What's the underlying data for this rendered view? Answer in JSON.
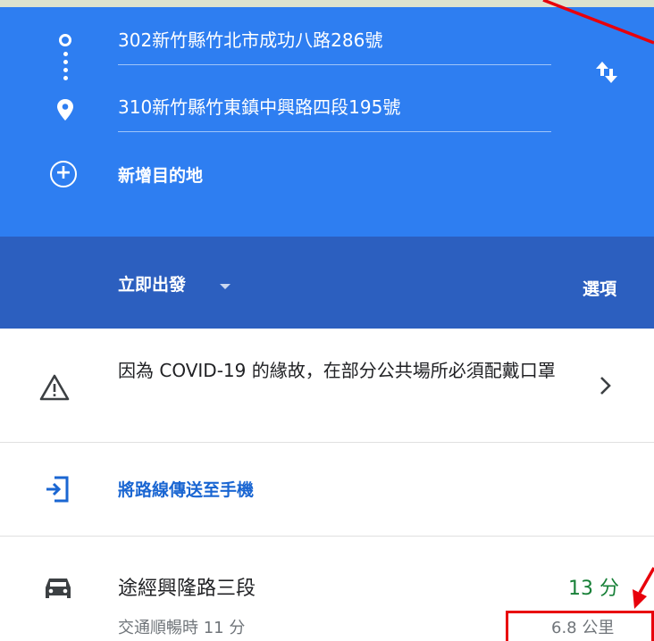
{
  "route": {
    "origin": "302新竹縣竹北市成功八路286號",
    "destination": "310新竹縣竹東鎮中興路四段195號",
    "add_destination_label": "新增目的地"
  },
  "departure": {
    "depart_label": "立即出發",
    "options_label": "選項"
  },
  "alert": {
    "text": "因為 COVID-19 的緣故，在部分公共場所必須配戴口罩"
  },
  "send_to_phone": {
    "label": "將路線傳送至手機"
  },
  "route_option": {
    "name": "途經興隆路三段",
    "traffic_note": "交通順暢時 11 分",
    "duration": "13 分",
    "distance": "6.8 公里"
  },
  "icons": {
    "origin": "trip-origin-icon",
    "waypoints": "waypoint-dots-icon",
    "destination": "place-pin-icon",
    "swap": "swap-vert-icon",
    "add": "add-circle-icon",
    "dropdown": "dropdown-caret-icon",
    "warning": "warning-icon",
    "chevron": "chevron-right-icon",
    "phone": "send-to-phone-icon",
    "car": "car-icon"
  },
  "colors": {
    "header_blue": "#2e7ef1",
    "depart_bar_blue": "#2c5fbf",
    "link_blue": "#1a66d2",
    "duration_green": "#188038",
    "annotation_red": "#e8000b"
  }
}
